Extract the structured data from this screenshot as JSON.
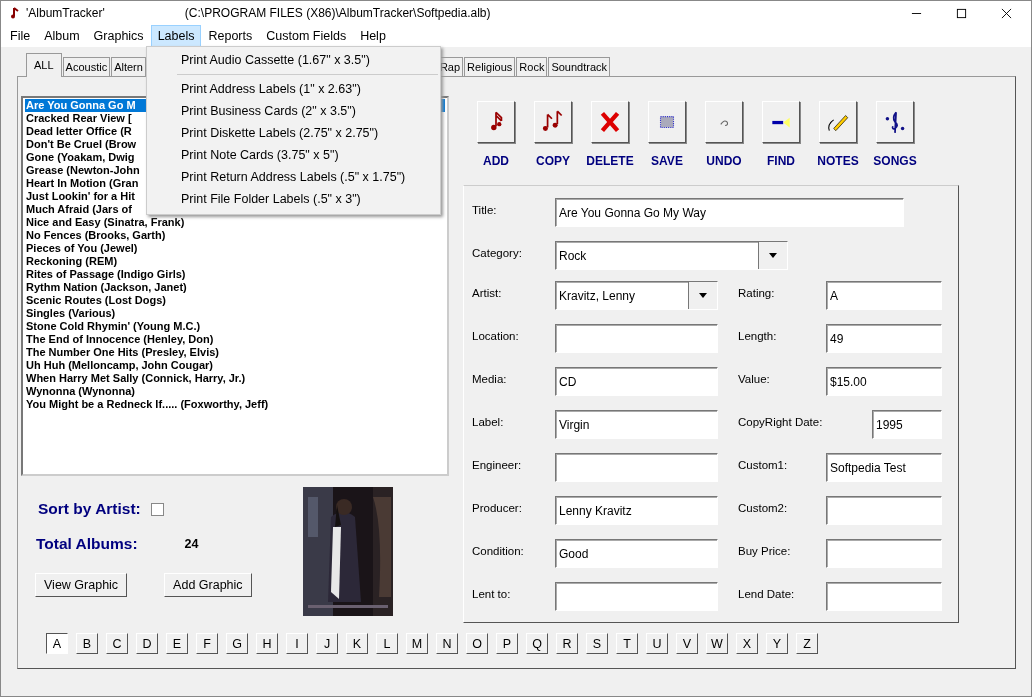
{
  "window": {
    "app_name": "'AlbumTracker'",
    "path": "(C:\\PROGRAM FILES (X86)\\AlbumTracker\\Softpedia.alb)"
  },
  "menu_bar": [
    {
      "label": "File",
      "selected": false
    },
    {
      "label": "Album",
      "selected": false
    },
    {
      "label": "Graphics",
      "selected": false
    },
    {
      "label": "Labels",
      "selected": true
    },
    {
      "label": "Reports",
      "selected": false
    },
    {
      "label": "Custom Fields",
      "selected": false
    },
    {
      "label": "Help",
      "selected": false
    }
  ],
  "open_menu": [
    {
      "kind": "item",
      "label": "Print Audio Cassette (1.67\" x 3.5\")"
    },
    {
      "kind": "separator"
    },
    {
      "kind": "item",
      "label": "Print Address Labels (1\" x 2.63\")"
    },
    {
      "kind": "item",
      "label": "Print Business Cards (2\" x 3.5\")"
    },
    {
      "kind": "item",
      "label": "Print Diskette Labels (2.75\" x 2.75\")"
    },
    {
      "kind": "item",
      "label": "Print Note Cards (3.75\" x 5\")"
    },
    {
      "kind": "item",
      "label": "Print Return Address Labels (.5\" x 1.75\")"
    },
    {
      "kind": "item",
      "label": "Print File Folder Labels (.5\" x 3\")"
    }
  ],
  "tabs_left": [
    {
      "label": "ALL",
      "selected": true
    },
    {
      "label": "Acoustic",
      "selected": false
    },
    {
      "label": "Altern",
      "selected": false
    }
  ],
  "tabs_right": [
    {
      "label": "Rap",
      "selected": false
    },
    {
      "label": "Religious",
      "selected": false
    },
    {
      "label": "Rock",
      "selected": false
    },
    {
      "label": "Soundtrack",
      "selected": false
    }
  ],
  "albums": [
    {
      "title": "Are You Gonna Go M",
      "selected": true
    },
    {
      "title": "Cracked Rear View [",
      "selected": false
    },
    {
      "title": "Dead letter Office (R",
      "selected": false
    },
    {
      "title": "Don't Be Cruel (Brow",
      "selected": false
    },
    {
      "title": "Gone (Yoakam, Dwig",
      "selected": false
    },
    {
      "title": "Grease (Newton-John",
      "selected": false
    },
    {
      "title": "Heart In Motion (Gran",
      "selected": false
    },
    {
      "title": "Just Lookin' for a Hit",
      "selected": false
    },
    {
      "title": "Much Afraid (Jars of",
      "selected": false
    },
    {
      "title": "Nice and Easy (Sinatra, Frank)",
      "selected": false
    },
    {
      "title": "No Fences (Brooks, Garth)",
      "selected": false
    },
    {
      "title": "Pieces of You (Jewel)",
      "selected": false
    },
    {
      "title": "Reckoning (REM)",
      "selected": false
    },
    {
      "title": "Rites of Passage (Indigo Girls)",
      "selected": false
    },
    {
      "title": "Rythm Nation (Jackson, Janet)",
      "selected": false
    },
    {
      "title": "Scenic Routes (Lost Dogs)",
      "selected": false
    },
    {
      "title": "Singles (Various)",
      "selected": false
    },
    {
      "title": "Stone Cold Rhymin' (Young M.C.)",
      "selected": false
    },
    {
      "title": "The End of Innocence (Henley, Don)",
      "selected": false
    },
    {
      "title": "The Number One Hits (Presley, Elvis)",
      "selected": false
    },
    {
      "title": "Uh Huh (Melloncamp, John Cougar)",
      "selected": false
    },
    {
      "title": "When Harry Met Sally (Connick, Harry, Jr.)",
      "selected": false
    },
    {
      "title": "Wynonna (Wynonna)",
      "selected": false
    },
    {
      "title": "You Might be a Redneck If..... (Foxworthy, Jeff)",
      "selected": false
    }
  ],
  "sort_by_artist": {
    "label": "Sort by Artist:",
    "checked": false
  },
  "total_albums": {
    "label": "Total Albums:",
    "value": "24"
  },
  "graphic_buttons": [
    "View Graphic",
    "Add Graphic"
  ],
  "cover": {
    "kind": "picture"
  },
  "toolbar": [
    "ADD",
    "COPY",
    "DELETE",
    "SAVE",
    "UNDO",
    "FIND",
    "NOTES",
    "SONGS"
  ],
  "form_wide": [
    {
      "label": "Title:",
      "value": "Are You Gonna Go My Way",
      "kind": "text"
    },
    {
      "label": "Category:",
      "value": "Rock",
      "kind": "dropdown"
    }
  ],
  "form_rows": [
    [
      {
        "label": "Artist:",
        "value": "Kravitz, Lenny",
        "kind": "dropdown"
      },
      {
        "label": "Rating:",
        "value": "A",
        "kind": "text"
      }
    ],
    [
      {
        "label": "Location:",
        "kind": "text"
      },
      {
        "label": "Length:",
        "value": "49",
        "kind": "text"
      }
    ],
    [
      {
        "label": "Media:",
        "value": "CD",
        "kind": "text"
      },
      {
        "label": "Value:",
        "value": "$15.00",
        "kind": "text"
      }
    ],
    [
      {
        "label": "Label:",
        "value": "Virgin",
        "kind": "text"
      },
      {
        "label": "CopyRight Date:",
        "value": "1995",
        "kind": "short"
      }
    ],
    [
      {
        "label": "Engineer:",
        "kind": "text"
      },
      {
        "label": "Custom1:",
        "value": "Softpedia Test",
        "kind": "text"
      }
    ],
    [
      {
        "label": "Producer:",
        "value": "Lenny Kravitz",
        "kind": "text"
      },
      {
        "label": "Custom2:",
        "kind": "text"
      }
    ],
    [
      {
        "label": "Condition:",
        "value": "Good",
        "kind": "text"
      },
      {
        "label": "Buy Price:",
        "kind": "text"
      }
    ],
    [
      {
        "label": "Lent to:",
        "kind": "text"
      },
      {
        "label": "Lend Date:",
        "kind": "text"
      }
    ]
  ],
  "letters": [
    {
      "label": "A",
      "selected": true
    },
    {
      "label": "B",
      "selected": false
    },
    {
      "label": "C",
      "selected": false
    },
    {
      "label": "D",
      "selected": false
    },
    {
      "label": "E",
      "selected": false
    },
    {
      "label": "F",
      "selected": false
    },
    {
      "label": "G",
      "selected": false
    },
    {
      "label": "H",
      "selected": false
    },
    {
      "label": "I",
      "selected": false
    },
    {
      "label": "J",
      "selected": false
    },
    {
      "label": "K",
      "selected": false
    },
    {
      "label": "L",
      "selected": false
    },
    {
      "label": "M",
      "selected": false
    },
    {
      "label": "N",
      "selected": false
    },
    {
      "label": "O",
      "selected": false
    },
    {
      "label": "P",
      "selected": false
    },
    {
      "label": "Q",
      "selected": false
    },
    {
      "label": "R",
      "selected": false
    },
    {
      "label": "S",
      "selected": false
    },
    {
      "label": "T",
      "selected": false
    },
    {
      "label": "U",
      "selected": false
    },
    {
      "label": "V",
      "selected": false
    },
    {
      "label": "W",
      "selected": false
    },
    {
      "label": "X",
      "selected": false
    },
    {
      "label": "Y",
      "selected": false
    },
    {
      "label": "Z",
      "selected": false
    }
  ]
}
